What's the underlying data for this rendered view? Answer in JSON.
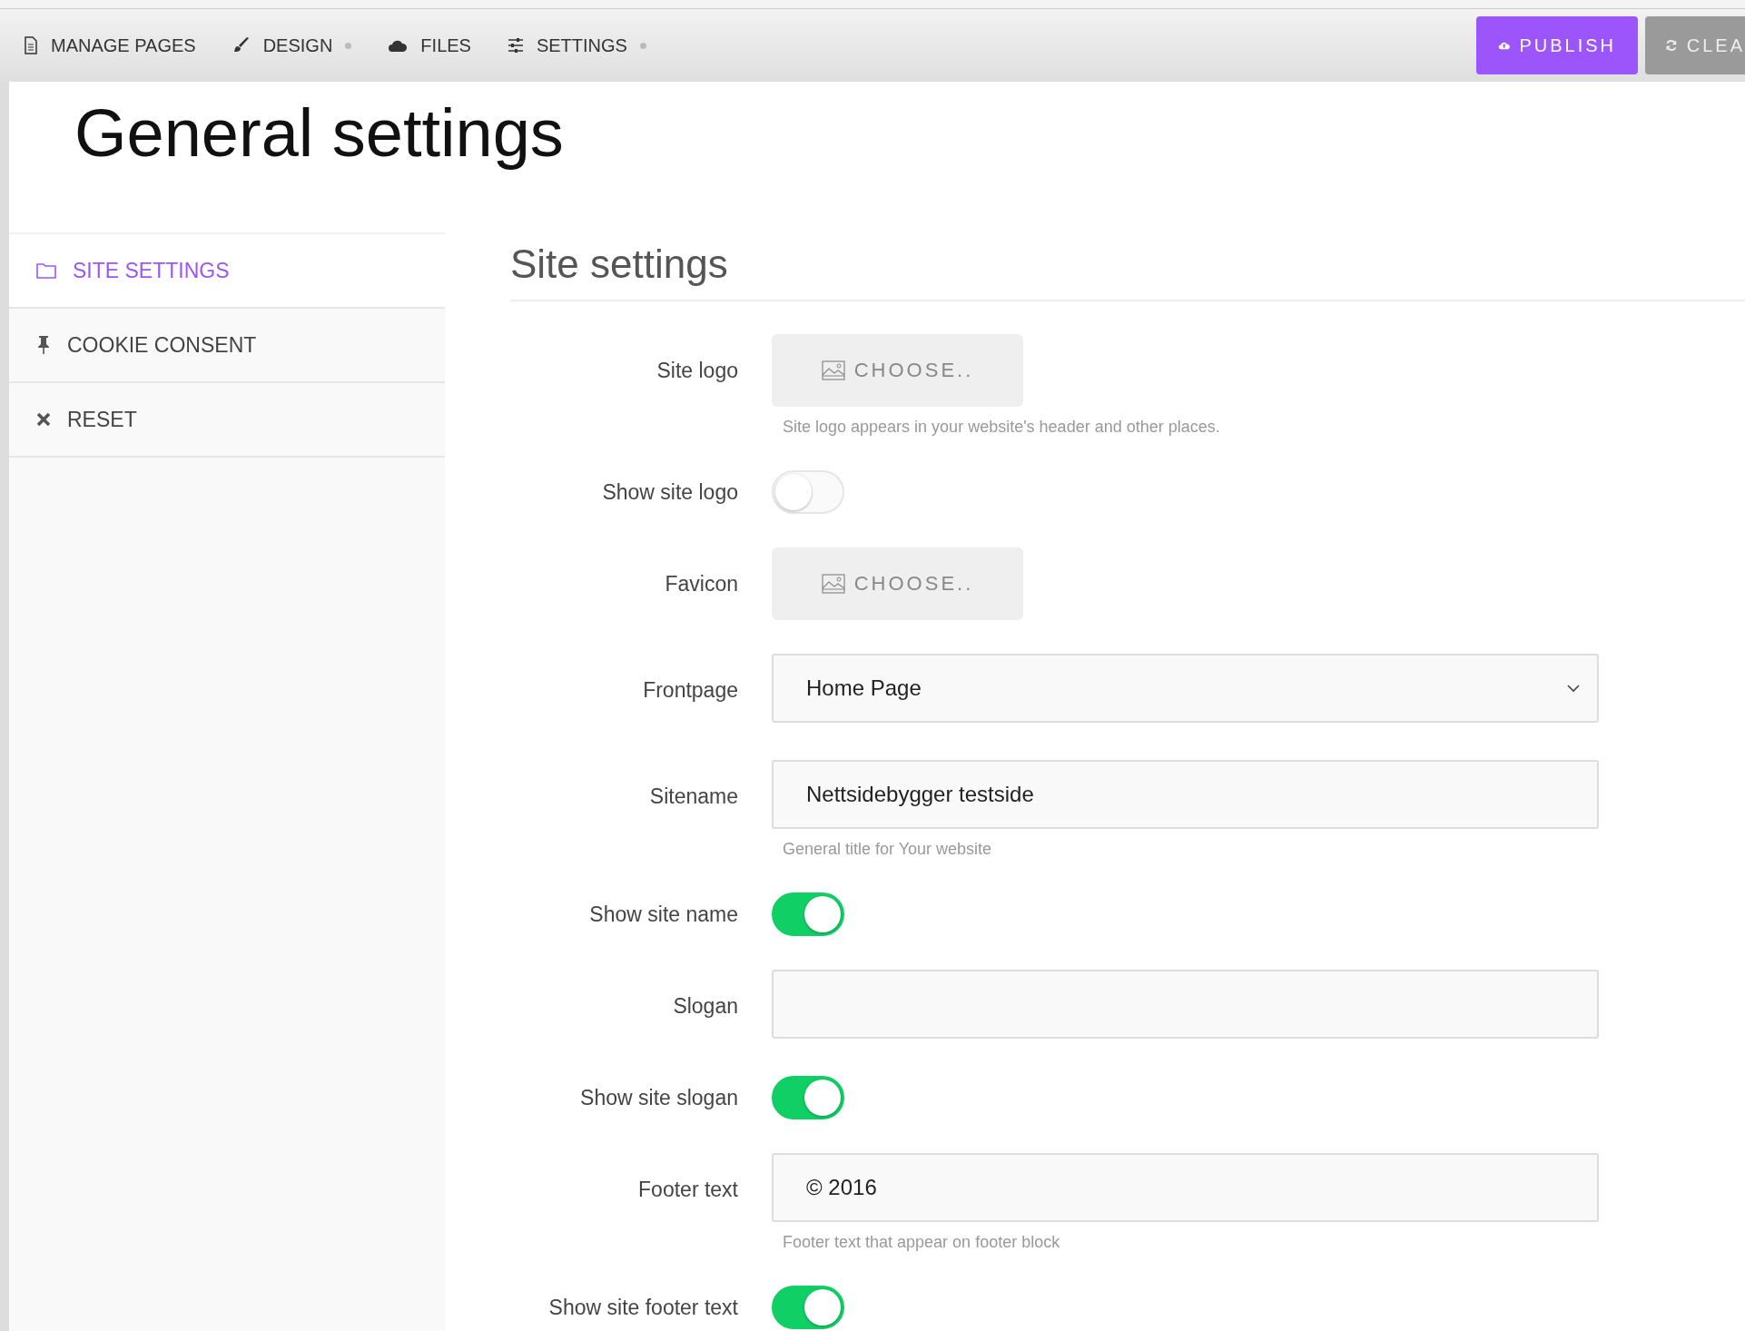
{
  "toolbar": {
    "items": [
      {
        "label": "MANAGE PAGES",
        "dot": false
      },
      {
        "label": "DESIGN",
        "dot": true
      },
      {
        "label": "FILES",
        "dot": false
      },
      {
        "label": "SETTINGS",
        "dot": true
      }
    ],
    "buttons": [
      {
        "label": "PUBLISH",
        "kind": "primary"
      },
      {
        "label": "CLEA",
        "kind": "secondary"
      }
    ]
  },
  "page_title": "General settings",
  "sidebar": {
    "items": [
      {
        "label": "SITE SETTINGS",
        "selected": true
      },
      {
        "label": "COOKIE CONSENT",
        "selected": false
      },
      {
        "label": "RESET",
        "selected": false
      }
    ]
  },
  "section_title": "Site settings",
  "form": [
    {
      "kind": "file",
      "label": "Site logo",
      "button": "CHOOSE..",
      "help": "Site logo appears in your website's header and other places."
    },
    {
      "kind": "toggle",
      "label": "Show site logo",
      "on": false
    },
    {
      "kind": "file",
      "label": "Favicon",
      "button": "CHOOSE.."
    },
    {
      "kind": "select",
      "label": "Frontpage",
      "value": "Home Page"
    },
    {
      "kind": "text",
      "label": "Sitename",
      "value": "Nettsidebygger testside",
      "help": "General title for Your website"
    },
    {
      "kind": "toggle",
      "label": "Show site name",
      "on": true
    },
    {
      "kind": "text",
      "label": "Slogan"
    },
    {
      "kind": "toggle",
      "label": "Show site slogan",
      "on": true
    },
    {
      "kind": "text",
      "label": "Footer text",
      "value": "© 2016",
      "help": "Footer text that appear on footer block"
    },
    {
      "kind": "toggle",
      "label": "Show site footer text",
      "on": true
    }
  ]
}
